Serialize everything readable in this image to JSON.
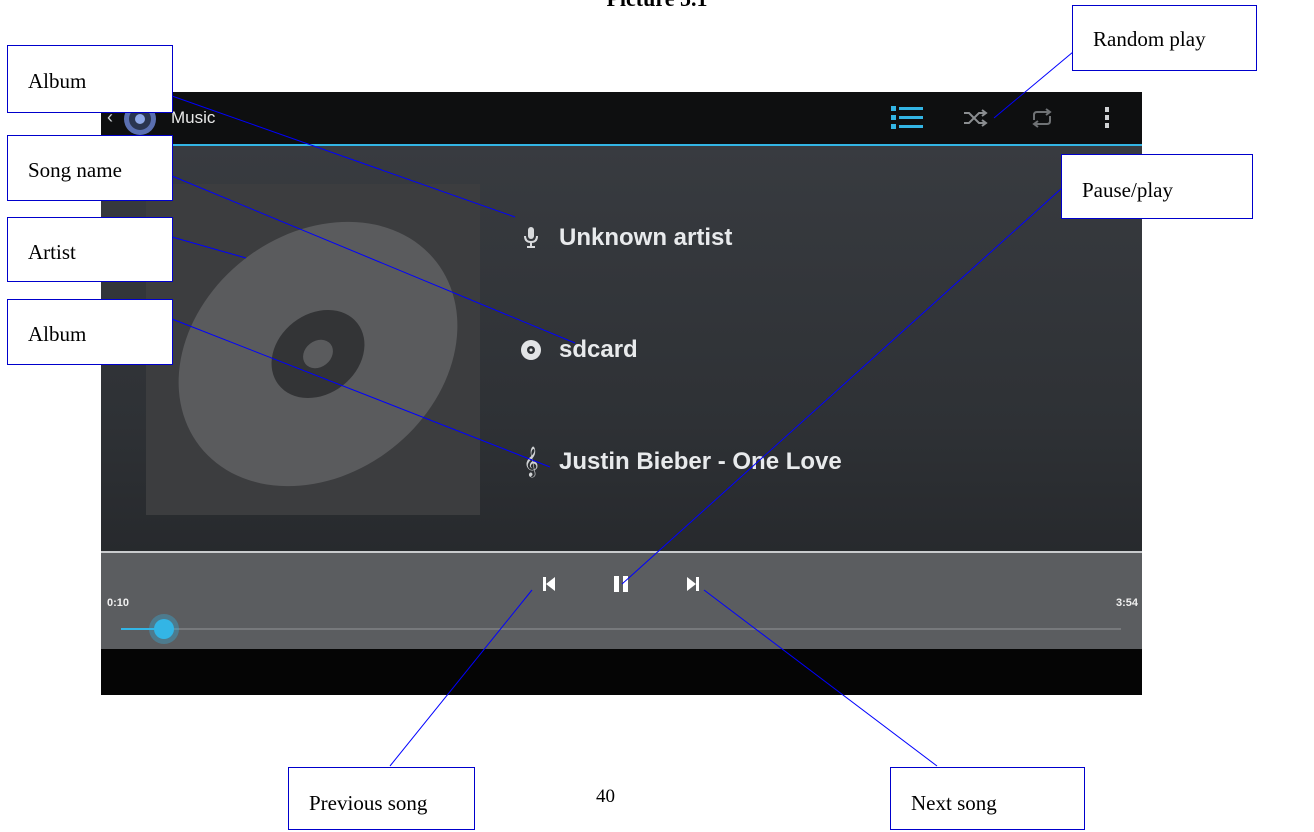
{
  "caption": "Picture 5.1",
  "app": {
    "title": "Music",
    "accent_color": "#33b5e5",
    "action_icons": [
      "list-icon",
      "shuffle-icon",
      "repeat-icon",
      "overflow-menu-icon"
    ]
  },
  "track": {
    "artist": "Unknown artist",
    "album": "sdcard",
    "song": "Justin Bieber - One Love",
    "elapsed": "0:10",
    "duration": "3:54",
    "progress_fraction": 0.043
  },
  "callouts": {
    "album_top": "Album",
    "song_name": "Song name",
    "artist": "Artist",
    "album_lower": "Album",
    "random_play": "Random play",
    "pause_play": "Pause/play",
    "previous_song": "Previous song",
    "next_song": "Next song"
  },
  "page_number": "40",
  "callout_line_color": "#0000ff"
}
